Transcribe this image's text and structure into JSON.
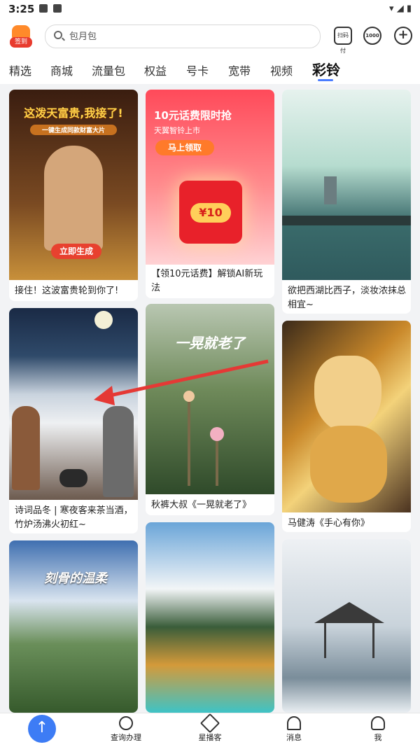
{
  "status_bar": {
    "time": "3:25"
  },
  "header": {
    "logo_tag": "签到",
    "search_placeholder": "包月包",
    "scan_label": "扫码付",
    "count_label": "1000"
  },
  "tabs": [
    "精选",
    "商城",
    "流量包",
    "权益",
    "号卡",
    "宽带",
    "视频",
    "彩铃"
  ],
  "active_tab": "彩铃",
  "cards": [
    {
      "caption": "接住！这波富贵轮到你了!",
      "overlay_title": "这泼天富贵,我接了!",
      "overlay_sub": "一键生成同款财富大片",
      "overlay_button": "立即生成"
    },
    {
      "caption": "【领10元话费】解锁AI新玩法",
      "overlay_title": "10元话费限时抢",
      "overlay_sub": "天翼智铃上市",
      "overlay_button": "马上领取",
      "overlay_amount": "¥10"
    },
    {
      "caption": "欲把西湖比西子，淡妆浓抹总相宜~"
    },
    {
      "caption": "诗词品冬 | 寒夜客来茶当酒，竹炉汤沸火初红~"
    },
    {
      "caption": "秋裤大叔《一晃就老了》",
      "overlay_title": "一晃就老了"
    },
    {
      "caption": "马健涛《手心有你》"
    },
    {
      "caption": "",
      "overlay_title": "刻骨的温柔"
    },
    {
      "caption": ""
    },
    {
      "caption": ""
    }
  ],
  "bottom_nav": [
    "查询办理",
    "星播客",
    "消息",
    "我"
  ],
  "colors": {
    "accent": "#3d7cf5",
    "brand_red": "#e8412f",
    "arrow": "#e53935"
  }
}
